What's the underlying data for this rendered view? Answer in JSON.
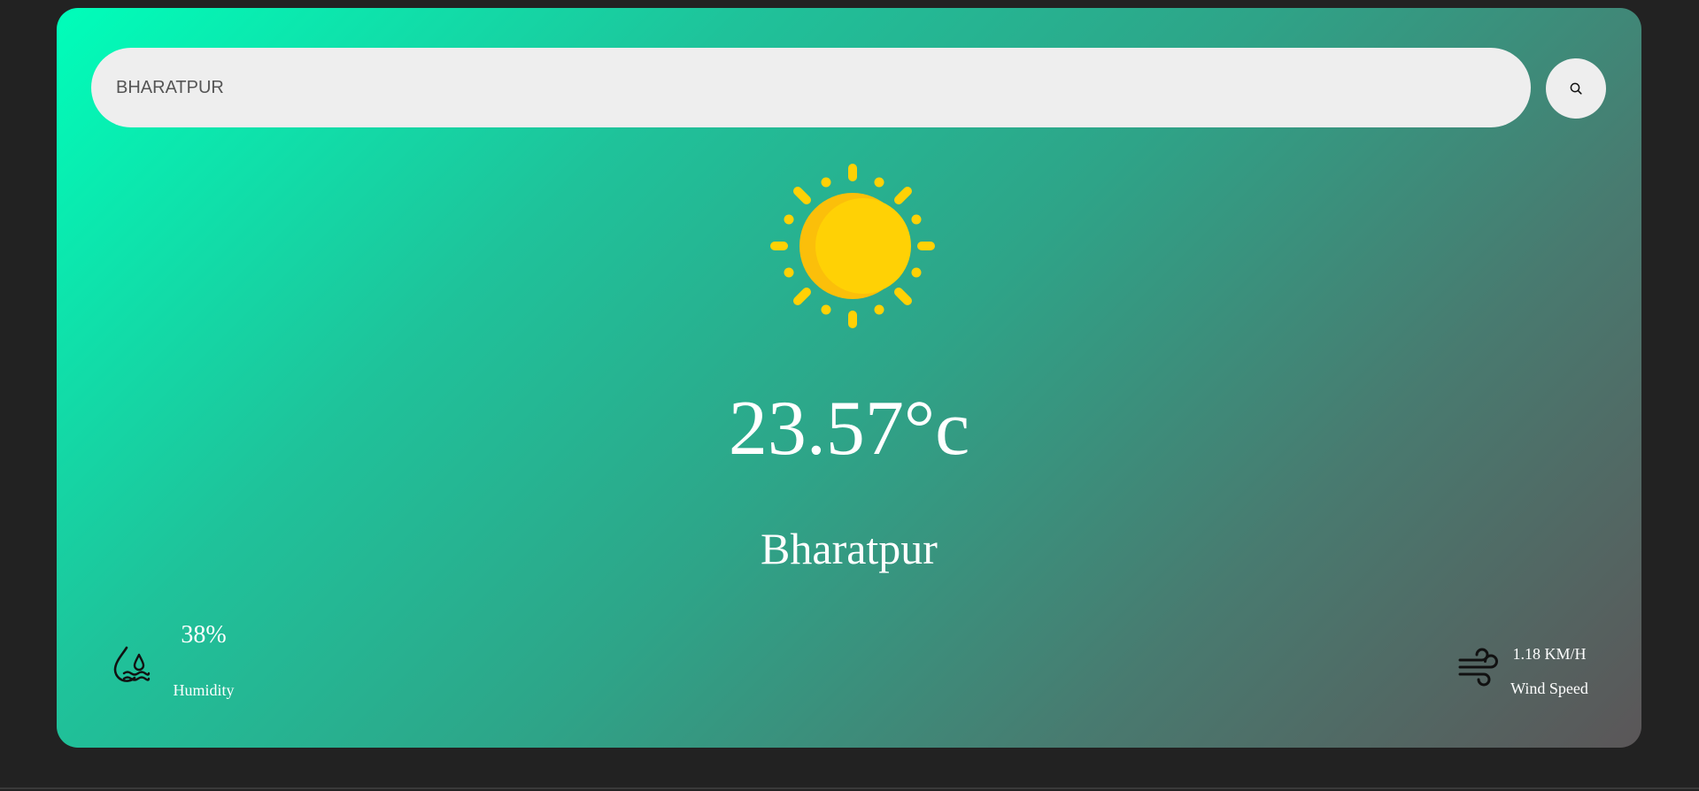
{
  "search": {
    "value": "BHARATPUR",
    "icon": "search-icon"
  },
  "weather": {
    "icon": "sun-icon",
    "temperature": "23.57°c",
    "city": "Bharatpur"
  },
  "details": {
    "humidity": {
      "icon": "humidity-icon",
      "value": "38%",
      "label": "Humidity"
    },
    "wind": {
      "icon": "wind-icon",
      "value": "1.18 KM/H",
      "label": "Wind Speed"
    }
  },
  "colors": {
    "page_background": "#222222",
    "gradient_start": "#00feba",
    "gradient_end": "#5b5658",
    "sun": "#ffd105",
    "sun_shade": "#fbbf0a",
    "text": "#ffffff",
    "input_background": "#eeeeee"
  }
}
